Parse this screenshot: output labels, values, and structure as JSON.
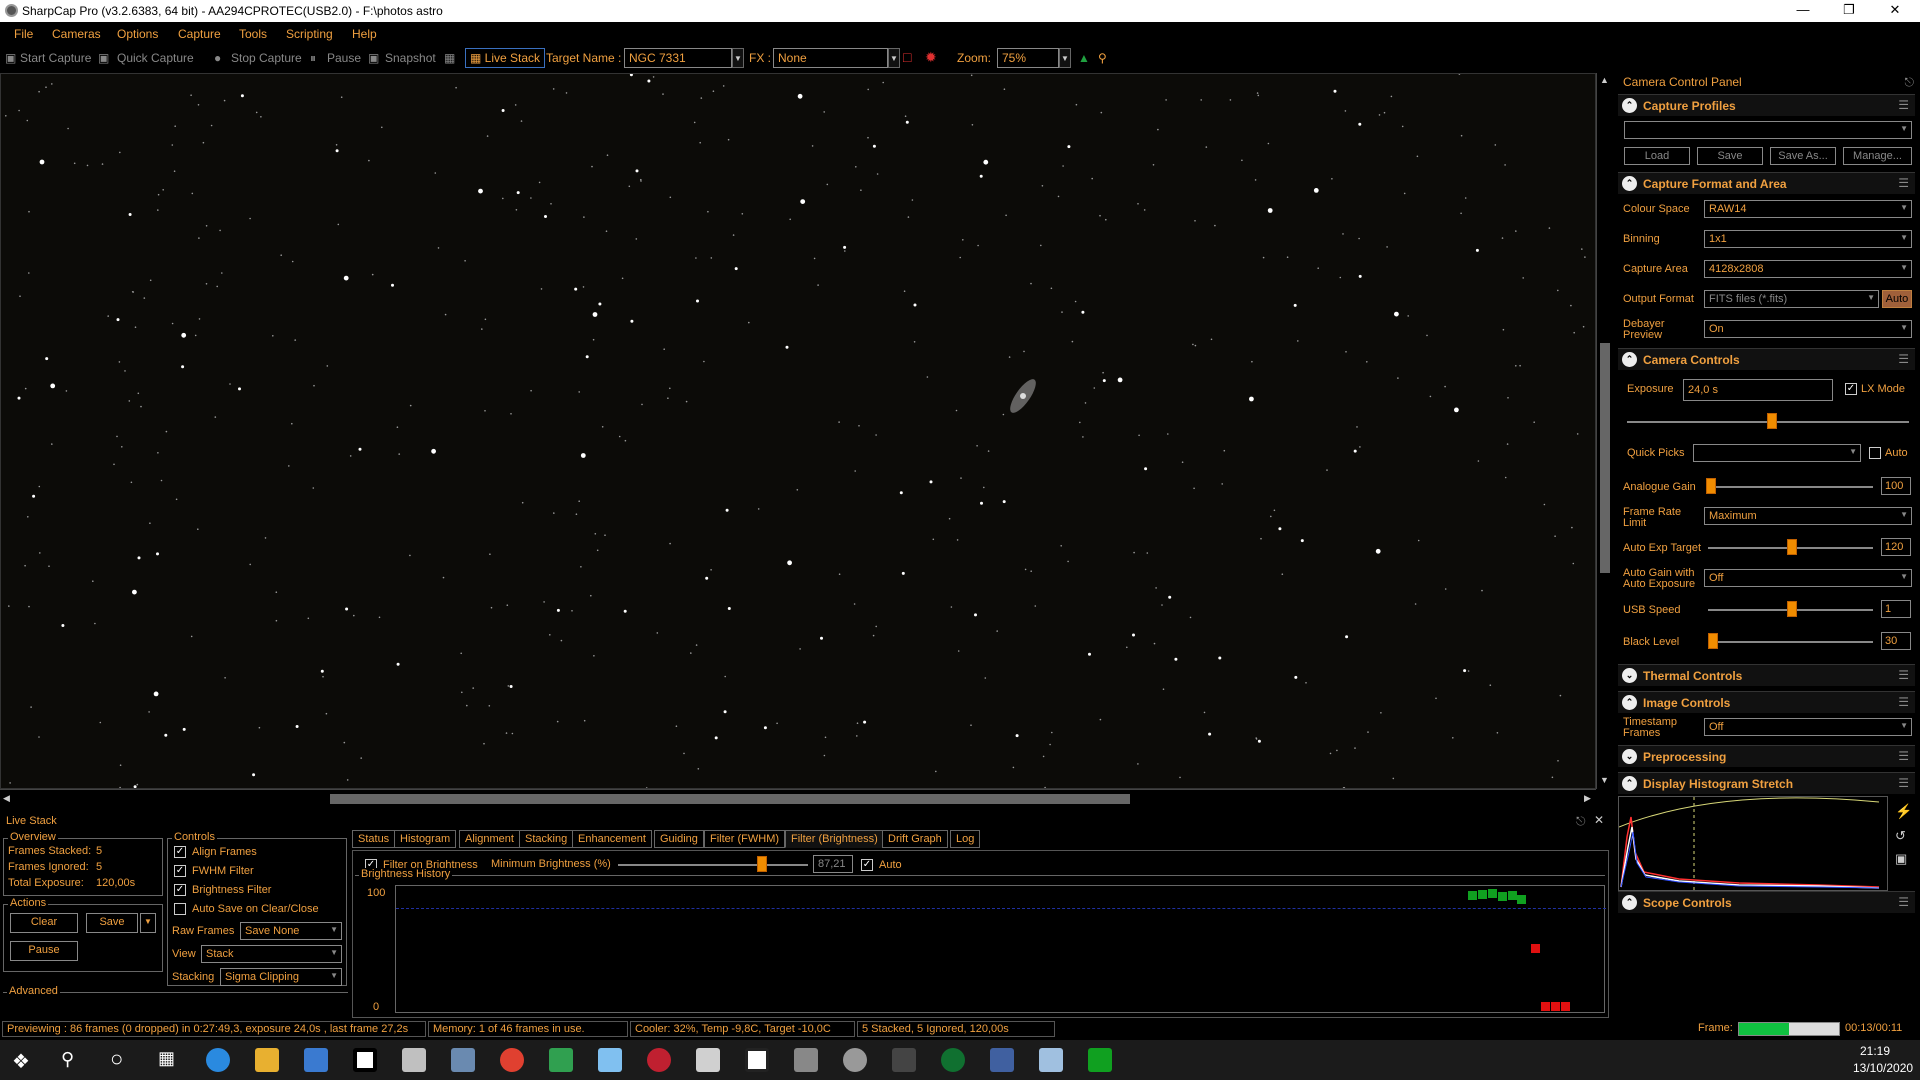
{
  "window": {
    "title": "SharpCap Pro (v3.2.6383, 64 bit) - AA294CPROTEC(USB2.0) - F:\\photos astro",
    "minimize_icon": "minimize-icon",
    "maximize_icon": "restore-icon",
    "close_icon": "close-icon"
  },
  "menu": [
    "File",
    "Cameras",
    "Options",
    "Capture",
    "Tools",
    "Scripting",
    "Help"
  ],
  "toolbar": {
    "start_capture": "Start Capture",
    "quick_capture": "Quick Capture",
    "stop_capture": "Stop Capture",
    "pause": "Pause",
    "snapshot": "Snapshot",
    "live_stack": "Live Stack",
    "target_name_label": "Target Name :",
    "target_name": "NGC 7331",
    "fx_label": "FX :",
    "fx_value": "None",
    "zoom_label": "Zoom:",
    "zoom_value": "75%"
  },
  "camera_panel": {
    "title": "Camera Control Panel",
    "capture_profiles": {
      "title": "Capture Profiles",
      "buttons": [
        "Load",
        "Save",
        "Save As...",
        "Manage..."
      ]
    },
    "capture_format": {
      "title": "Capture Format and Area",
      "colour_space_label": "Colour Space",
      "colour_space": "RAW14",
      "binning_label": "Binning",
      "binning": "1x1",
      "capture_area_label": "Capture Area",
      "capture_area": "4128x2808",
      "output_format_label": "Output Format",
      "output_format": "FITS files (*.fits)",
      "auto_label": "Auto",
      "debayer_label": "Debayer Preview",
      "debayer": "On"
    },
    "camera_controls": {
      "title": "Camera Controls",
      "exposure_label": "Exposure",
      "exposure": "24,0 s",
      "lx_mode_label": "LX Mode",
      "quick_picks_label": "Quick Picks",
      "quick_picks_auto": "Auto",
      "analogue_gain_label": "Analogue Gain",
      "analogue_gain": "100",
      "frame_rate_label": "Frame Rate Limit",
      "frame_rate": "Maximum",
      "auto_exp_label": "Auto Exp Target",
      "auto_exp": "120",
      "auto_gain_label": "Auto Gain with Auto Exposure",
      "auto_gain": "Off",
      "usb_speed_label": "USB Speed",
      "usb_speed": "1",
      "black_level_label": "Black Level",
      "black_level": "30"
    },
    "thermal_title": "Thermal Controls",
    "image_controls": {
      "title": "Image Controls",
      "timestamp_label": "Timestamp Frames",
      "timestamp": "Off"
    },
    "preprocessing_title": "Preprocessing",
    "histogram_title": "Display Histogram Stretch",
    "scope_title": "Scope Controls"
  },
  "live_stack": {
    "title": "Live Stack",
    "overview_title": "Overview",
    "frames_stacked_label": "Frames Stacked:",
    "frames_stacked": "5",
    "frames_ignored_label": "Frames Ignored:",
    "frames_ignored": "5",
    "total_exposure_label": "Total Exposure:",
    "total_exposure": "120,00s",
    "actions_title": "Actions",
    "clear": "Clear",
    "save": "Save",
    "pause": "Pause",
    "advanced_title": "Advanced",
    "controls_title": "Controls",
    "align_frames": "Align Frames",
    "fwhm_filter": "FWHM Filter",
    "brightness_filter": "Brightness Filter",
    "auto_save": "Auto Save on Clear/Close",
    "raw_frames_label": "Raw Frames",
    "raw_frames": "Save None",
    "view_label": "View",
    "view": "Stack",
    "stacking_label": "Stacking",
    "stacking": "Sigma Clipping",
    "tabs": [
      "Status",
      "Histogram",
      "Alignment",
      "Stacking",
      "Enhancement",
      "Guiding",
      "Filter (FWHM)",
      "Filter (Brightness)",
      "Drift Graph",
      "Log"
    ],
    "filter_on_brightness": "Filter on Brightness",
    "min_brightness_label": "Minimum Brightness (%)",
    "min_brightness": "87,21",
    "min_brightness_fraction": 0.76,
    "auto_label": "Auto",
    "history_title": "Brightness History",
    "y_max": "100",
    "y_min": "0"
  },
  "status": {
    "previewing": "Previewing : 86 frames (0 dropped) in 0:27:49,3, exposure 24,0s , last frame 27,2s",
    "memory": "Memory: 1 of 46 frames in use.",
    "cooler": "Cooler: 32%, Temp -9,8C, Target -10,0C",
    "stacked": "5 Stacked, 5 Ignored, 120,00s",
    "frame_label": "Frame:",
    "frame_progress": 0.5,
    "frame_time": "00:13/00:11"
  },
  "taskbar": {
    "time": "21:19",
    "date": "13/10/2020"
  },
  "colors": {
    "accent": "#f0a040",
    "background": "#000000",
    "progress": "#10c040"
  }
}
